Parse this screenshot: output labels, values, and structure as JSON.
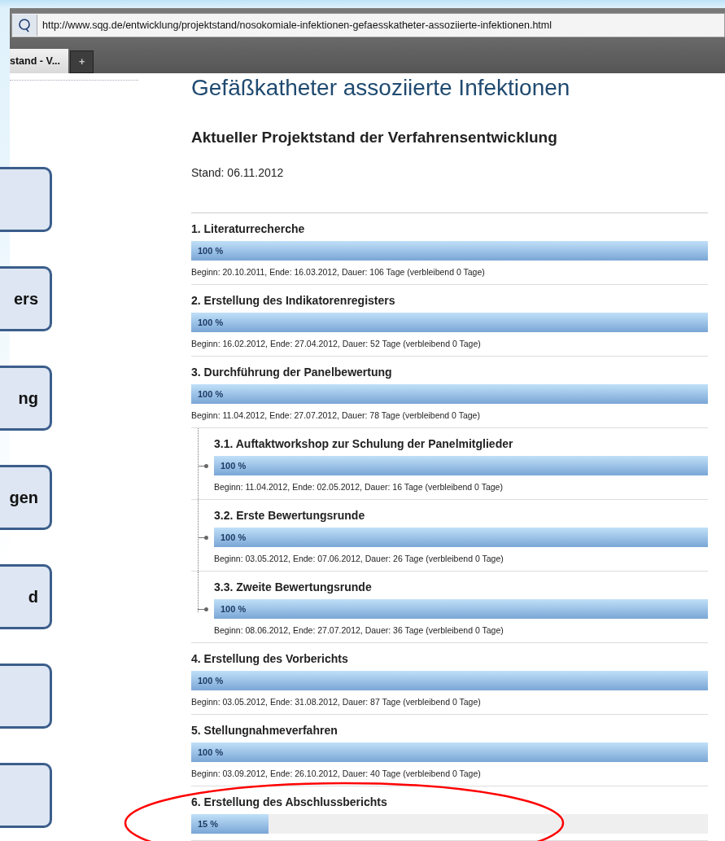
{
  "browser": {
    "url": "http://www.sqg.de/entwicklung/projektstand/nosokomiale-infektionen-gefaesskatheter-assoziierte-infektionen.html",
    "tabs": [
      {
        "label": "stand - V...",
        "selected": true
      },
      {
        "label": "+",
        "selected": false
      }
    ]
  },
  "sidebar": {
    "items": [
      {
        "kind": "nav-box"
      },
      {
        "kind": "nav-box",
        "label": "ers"
      },
      {
        "kind": "nav-box",
        "label": "ng"
      },
      {
        "kind": "nav-box",
        "label": "gen"
      },
      {
        "kind": "nav-box",
        "label": "d"
      },
      {
        "kind": "nav-box"
      },
      {
        "kind": "nav-box"
      }
    ]
  },
  "page": {
    "title": "Gefäßkatheter assoziierte Infektionen",
    "subtitle": "Aktueller Projektstand der Verfahrensentwicklung",
    "stand": "Stand: 06.11.2012",
    "phases": [
      {
        "title": "1. Literaturrecherche",
        "level": 1,
        "progress": "100 %",
        "dates": "Beginn: 20.10.2011, Ende: 16.03.2012, Dauer: 106 Tage (verbleibend 0 Tage)"
      },
      {
        "title": "2. Erstellung des Indikatorenregisters",
        "level": 1,
        "progress": "100 %",
        "dates": "Beginn: 16.02.2012, Ende: 27.04.2012, Dauer: 52 Tage (verbleibend 0 Tage)"
      },
      {
        "title": "3. Durchführung der Panelbewertung",
        "level": 1,
        "progress": "100 %",
        "dates": "Beginn: 11.04.2012, Ende: 27.07.2012, Dauer: 78 Tage (verbleibend 0 Tage)",
        "children": [
          {
            "title": "3.1. Auftaktworkshop zur Schulung der Panelmitglieder",
            "level": 1,
            "progress": "100 %",
            "dates": "Beginn: 11.04.2012, Ende: 02.05.2012, Dauer: 16 Tage (verbleibend 0 Tage)"
          },
          {
            "title": "3.2. Erste Bewertungsrunde",
            "level": 1,
            "progress": "100 %",
            "dates": "Beginn: 03.05.2012, Ende: 07.06.2012, Dauer: 26 Tage (verbleibend 0 Tage)"
          },
          {
            "title": "3.3. Zweite Bewertungsrunde",
            "level": 1,
            "progress": "100 %",
            "dates": "Beginn: 08.06.2012, Ende: 27.07.2012, Dauer: 36 Tage (verbleibend 0 Tage)"
          }
        ]
      },
      {
        "title": "4. Erstellung des Vorberichts",
        "level": 1,
        "progress": "100 %",
        "dates": "Beginn: 03.05.2012, Ende: 31.08.2012, Dauer: 87 Tage (verbleibend 0 Tage)"
      },
      {
        "title": "5. Stellungnahmeverfahren",
        "level": 1,
        "progress": "100 %",
        "dates": "Beginn: 03.09.2012, Ende: 26.10.2012, Dauer: 40 Tage (verbleibend 0 Tage)"
      },
      {
        "title": "6. Erstellung des Abschlussberichts",
        "level": 0.15,
        "progress": "15 %",
        "highlighted": true
      }
    ]
  }
}
